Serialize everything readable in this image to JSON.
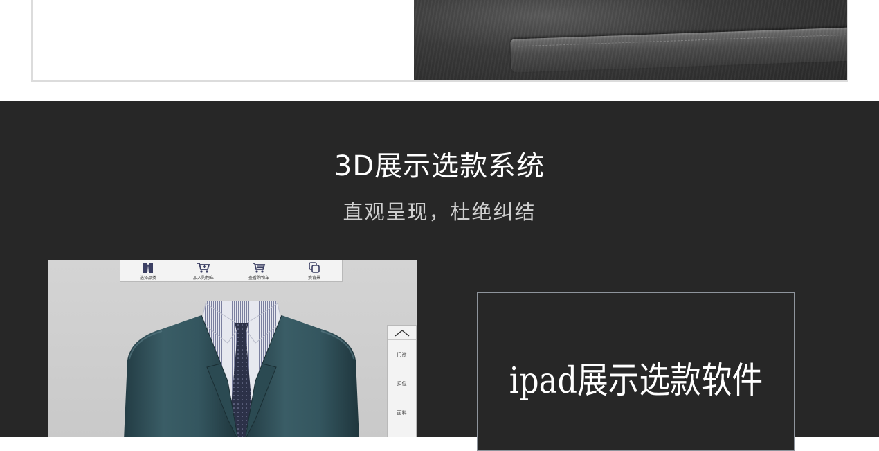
{
  "section": {
    "title": "3D展示选款系统",
    "subtitle": "直观呈现，杜绝纠结"
  },
  "ipad_app": {
    "toolbar": [
      {
        "label": "选择品类",
        "icon": "suit-icon"
      },
      {
        "label": "加入购物车",
        "icon": "cart-add-icon"
      },
      {
        "label": "查看购物车",
        "icon": "cart-view-icon"
      },
      {
        "label": "换背景",
        "icon": "background-swap-icon"
      }
    ],
    "side_menu": {
      "up_icon": "chevron-up-icon",
      "items": [
        "门襟",
        "扣位",
        "面料",
        "…"
      ]
    },
    "preview": "suit-3d-model"
  },
  "caption": {
    "text": "ipad展示选款软件"
  },
  "colors": {
    "dark_background": "#272727",
    "suit": "#2f4f57",
    "frame_border": "#8e949c"
  }
}
